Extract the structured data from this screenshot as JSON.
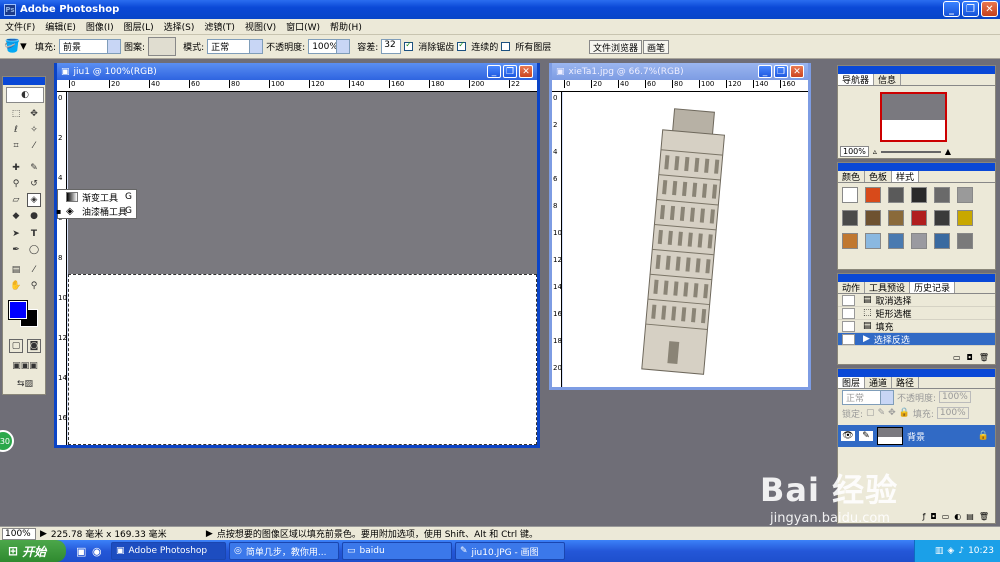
{
  "app": {
    "title": "Adobe Photoshop"
  },
  "menu": [
    "文件(F)",
    "编辑(E)",
    "图像(I)",
    "图层(L)",
    "选择(S)",
    "滤镜(T)",
    "视图(V)",
    "窗口(W)",
    "帮助(H)"
  ],
  "options": {
    "fill_label": "填充:",
    "fill_value": "前景",
    "pattern_label": "图案:",
    "mode_label": "模式:",
    "mode_value": "正常",
    "opacity_label": "不透明度:",
    "opacity_value": "100%",
    "tolerance_label": "容差:",
    "tolerance_value": "32",
    "antialias_label": "消除锯齿",
    "contiguous_label": "连续的",
    "all_layers_label": "所有图层",
    "file_browser_tab": "文件浏览器",
    "brushes_tab": "画笔"
  },
  "flyout": [
    {
      "label": "渐变工具",
      "key": "G"
    },
    {
      "label": "油漆桶工具",
      "key": "G"
    }
  ],
  "doc1": {
    "title": "jiu1 @ 100%(RGB)",
    "ruler_labels": [
      "0",
      "20",
      "40",
      "60",
      "80",
      "100",
      "120",
      "140",
      "160",
      "180",
      "200",
      "22"
    ],
    "vruler_labels": [
      "0",
      "2",
      "4",
      "6",
      "8",
      "10",
      "12",
      "14",
      "16"
    ]
  },
  "doc2": {
    "title": "xieTa1.jpg @ 66.7%(RGB)",
    "ruler_labels": [
      "0",
      "20",
      "40",
      "60",
      "80",
      "100",
      "120",
      "140",
      "160"
    ],
    "vruler_labels": [
      "0",
      "2",
      "4",
      "6",
      "8",
      "10",
      "12",
      "14",
      "16",
      "18",
      "20"
    ]
  },
  "navigator": {
    "tabs": [
      "导航器",
      "信息"
    ],
    "zoom": "100%"
  },
  "swatches": {
    "tabs": [
      "颜色",
      "色板",
      "样式"
    ]
  },
  "history": {
    "tabs": [
      "动作",
      "工具预设",
      "历史记录"
    ],
    "items": [
      "取消选择",
      "矩形选框",
      "填充",
      "选择反选"
    ]
  },
  "layers": {
    "tabs": [
      "图层",
      "通道",
      "路径"
    ],
    "mode": "正常",
    "opacity_label": "不透明度:",
    "opacity": "100%",
    "lock_label": "锁定:",
    "fill_label": "填充:",
    "fill": "100%",
    "layer_name": "背景"
  },
  "status": {
    "zoom": "100%",
    "size": "225.78 毫米 x 169.33 毫米",
    "hint": "点按想要的图像区域以填充前景色。要用附加选项，使用 Shift、Alt 和 Ctrl 键。"
  },
  "taskbar": {
    "start": "开始",
    "tasks": [
      "Adobe Photoshop",
      "简单几步，教你用...",
      "baidu",
      "jiu10.JPG - 画图"
    ],
    "time": "10:23"
  },
  "watermark": {
    "brand": "Bai 经验",
    "url": "jingyan.baidu.com"
  },
  "colors": {
    "foreground": "#0000ff",
    "background": "#000000",
    "title_blue": "#0a48d6",
    "canvas_grey": "#7a797f"
  }
}
